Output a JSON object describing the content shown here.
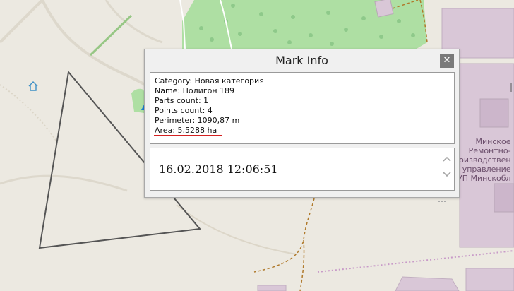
{
  "dialog": {
    "title": "Mark Info",
    "close_symbol": "✕",
    "info_lines": [
      "Category: Новая категория",
      "Name: Полигон 189",
      "Parts count: 1",
      "Points count: 4",
      "Perimeter: 1090,87 m",
      "Area: 5,5288 ha"
    ],
    "date_text": "16.02.2018 12:06:51",
    "scroll_up_icon": "chevron-up-icon",
    "scroll_down_icon": "chevron-down-icon",
    "highlight_color": "#d42020"
  },
  "map": {
    "building_label_lines": [
      "Минское",
      "Ремонтно-",
      "оизводствен",
      "управление",
      "УП Минскобл"
    ],
    "colors": {
      "background": "#ece9e1",
      "forest": "#aedfa3",
      "building": "#d9c7d7",
      "polygon": "#555555",
      "path": "#b07a2c"
    }
  }
}
